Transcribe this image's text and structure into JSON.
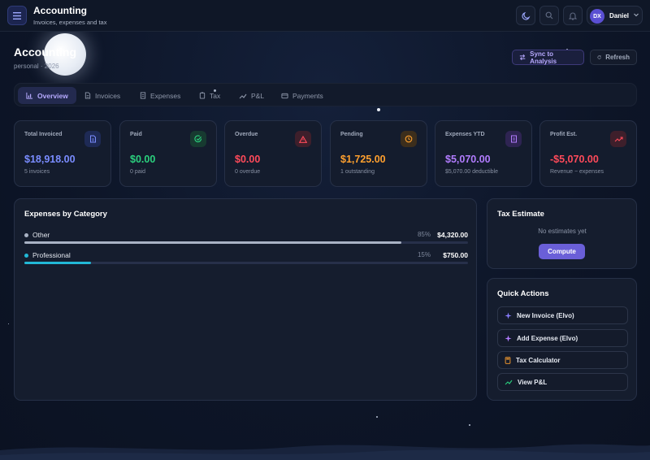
{
  "app": {
    "title": "Accounting",
    "subtitle": "Invoices, expenses and tax"
  },
  "user": {
    "initials": "DX",
    "name": "Daniel"
  },
  "header": {
    "title": "Accounting",
    "subtitle": "personal · 2026",
    "sync_label": "Sync to Analysis",
    "refresh_label": "Refresh"
  },
  "tabs": [
    {
      "label": "Overview",
      "icon": "bar-chart-icon",
      "active": true
    },
    {
      "label": "Invoices",
      "icon": "document-icon",
      "active": false
    },
    {
      "label": "Expenses",
      "icon": "receipt-icon",
      "active": false
    },
    {
      "label": "Tax",
      "icon": "clipboard-icon",
      "active": false
    },
    {
      "label": "P&L",
      "icon": "trend-icon",
      "active": false
    },
    {
      "label": "Payments",
      "icon": "wallet-icon",
      "active": false
    }
  ],
  "stats": [
    {
      "label": "Total Invoiced",
      "value": "$18,918.00",
      "note": "5 invoices",
      "color": "#7a8cff",
      "icon": "document-icon"
    },
    {
      "label": "Paid",
      "value": "$0.00",
      "note": "0 paid",
      "color": "#2bd17e",
      "icon": "check-circle-icon"
    },
    {
      "label": "Overdue",
      "value": "$0.00",
      "note": "0 overdue",
      "color": "#ff4a5a",
      "icon": "warning-icon"
    },
    {
      "label": "Pending",
      "value": "$1,725.00",
      "note": "1 outstanding",
      "color": "#ffa02e",
      "icon": "clock-icon"
    },
    {
      "label": "Expenses YTD",
      "value": "$5,070.00",
      "note": "$5,070.00 deductible",
      "color": "#b27cff",
      "icon": "receipt-icon"
    },
    {
      "label": "Profit Est.",
      "value": "-$5,070.00",
      "note": "Revenue − expenses",
      "color": "#ff4a5a",
      "icon": "trend-up-icon"
    }
  ],
  "expenses": {
    "title": "Expenses by Category",
    "categories": [
      {
        "name": "Other",
        "percent": "85%",
        "amount": "$4,320.00",
        "fraction": 0.85,
        "color": "#a9b2c4"
      },
      {
        "name": "Professional",
        "percent": "15%",
        "amount": "$750.00",
        "fraction": 0.15,
        "color": "#22b8d6"
      }
    ]
  },
  "tax": {
    "title": "Tax Estimate",
    "empty_text": "No estimates yet",
    "compute_label": "Compute"
  },
  "quick_actions": {
    "title": "Quick Actions",
    "items": [
      {
        "label": "New Invoice (Elvo)",
        "icon": "sparkle-icon"
      },
      {
        "label": "Add Expense (Elvo)",
        "icon": "sparkle-icon"
      },
      {
        "label": "Tax Calculator",
        "icon": "calculator-icon"
      },
      {
        "label": "View P&L",
        "icon": "trend-icon"
      }
    ]
  }
}
